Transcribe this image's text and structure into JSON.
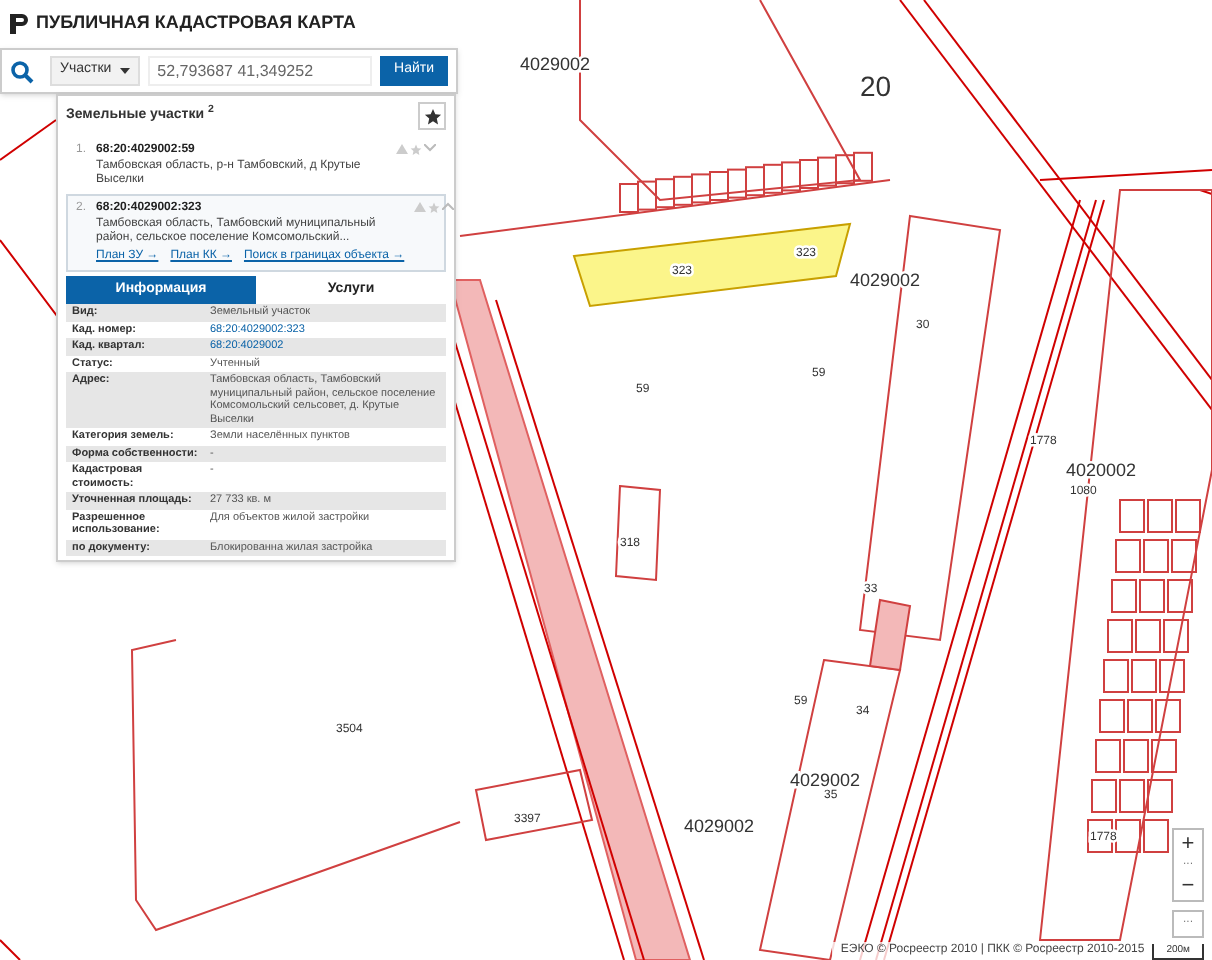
{
  "header": {
    "title": "ПУБЛИЧНАЯ КАДАСТРОВАЯ КАРТА"
  },
  "search": {
    "type": "Участки",
    "value": "52,793687 41,349252",
    "button": "Найти"
  },
  "results": {
    "title": "Земельные участки",
    "count": "2",
    "items": [
      {
        "index": "1.",
        "number": "68:20:4029002:59",
        "address": "Тамбовская область, р-н Тамбовский, д Крутые Выселки",
        "expanded": false
      },
      {
        "index": "2.",
        "number": "68:20:4029002:323",
        "address": "Тамбовская область, Тамбовский муниципальный район, сельское поселение Комсомольский...",
        "expanded": true,
        "links": [
          "План ЗУ →",
          "План КК →",
          "Поиск в границах объекта →"
        ]
      }
    ]
  },
  "tabs": [
    {
      "label": "Информация",
      "selected": true
    },
    {
      "label": "Услуги",
      "selected": false
    }
  ],
  "info": [
    {
      "label": "Вид:",
      "value": "Земельный участок",
      "kind": "text"
    },
    {
      "label": "Кад. номер:",
      "value": "68:20:4029002:323",
      "kind": "link"
    },
    {
      "label": "Кад. квартал:",
      "value": "68:20:4029002",
      "kind": "link"
    },
    {
      "label": "Статус:",
      "value": "Учтенный",
      "kind": "text"
    },
    {
      "label": "Адрес:",
      "value": "Тамбовская область, Тамбовский муниципальный район, сельское поселение Комсомольский сельсовет, д. Крутые Выселки",
      "kind": "text"
    },
    {
      "label": "Категория земель:",
      "value": "Земли населённых пунктов",
      "kind": "text"
    },
    {
      "label": "Форма собственности:",
      "value": "-",
      "kind": "text"
    },
    {
      "label": "Кадастровая стоимость:",
      "value": "-",
      "kind": "text"
    },
    {
      "label": "Уточненная площадь:",
      "value": "27 733 кв. м",
      "kind": "text"
    },
    {
      "label": "Разрешенное использование:",
      "value": "Для объектов жилой застройки",
      "kind": "text"
    },
    {
      "label": "по документу:",
      "value": "Блокированна жилая застройка",
      "kind": "text"
    }
  ],
  "map": {
    "labels": [
      "20",
      "4029002",
      "4029002",
      "323",
      "323",
      "59",
      "59",
      "30",
      "59",
      "34",
      "4029002",
      "35",
      "4029002",
      "3504",
      "3397",
      "318",
      "1778",
      "4020002",
      "1080",
      "1778",
      "33"
    ]
  },
  "zoom": {
    "plus": "+",
    "minus": "−",
    "more": "···"
  },
  "footer": {
    "attribution": "ЕЭКО © Росреестр 2010 | ПКК © Росреестр 2010-2015",
    "scale": "200м"
  }
}
